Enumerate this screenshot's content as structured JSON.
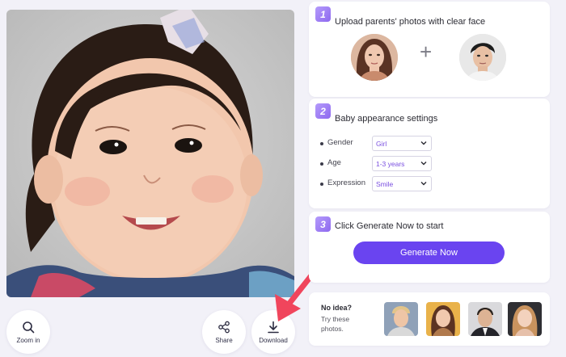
{
  "result": {
    "zoom_label": "Zoom in",
    "share_label": "Share",
    "download_label": "Download"
  },
  "step1": {
    "number": "1",
    "title": "Upload parents' photos with clear face",
    "plus": "+"
  },
  "step2": {
    "number": "2",
    "title": "Baby appearance settings",
    "settings": [
      {
        "name": "Gender",
        "value": "Girl"
      },
      {
        "name": "Age",
        "value": "1-3 years"
      },
      {
        "name": "Expression",
        "value": "Smile"
      }
    ]
  },
  "step3": {
    "number": "3",
    "title": "Click Generate Now to start",
    "button_label": "Generate Now"
  },
  "suggest": {
    "title": "No idea?",
    "subtitle": "Try these photos."
  },
  "colors": {
    "accent": "#6a44f0",
    "step_badge": "#8e68ef",
    "annotation_arrow": "#f0455c"
  }
}
